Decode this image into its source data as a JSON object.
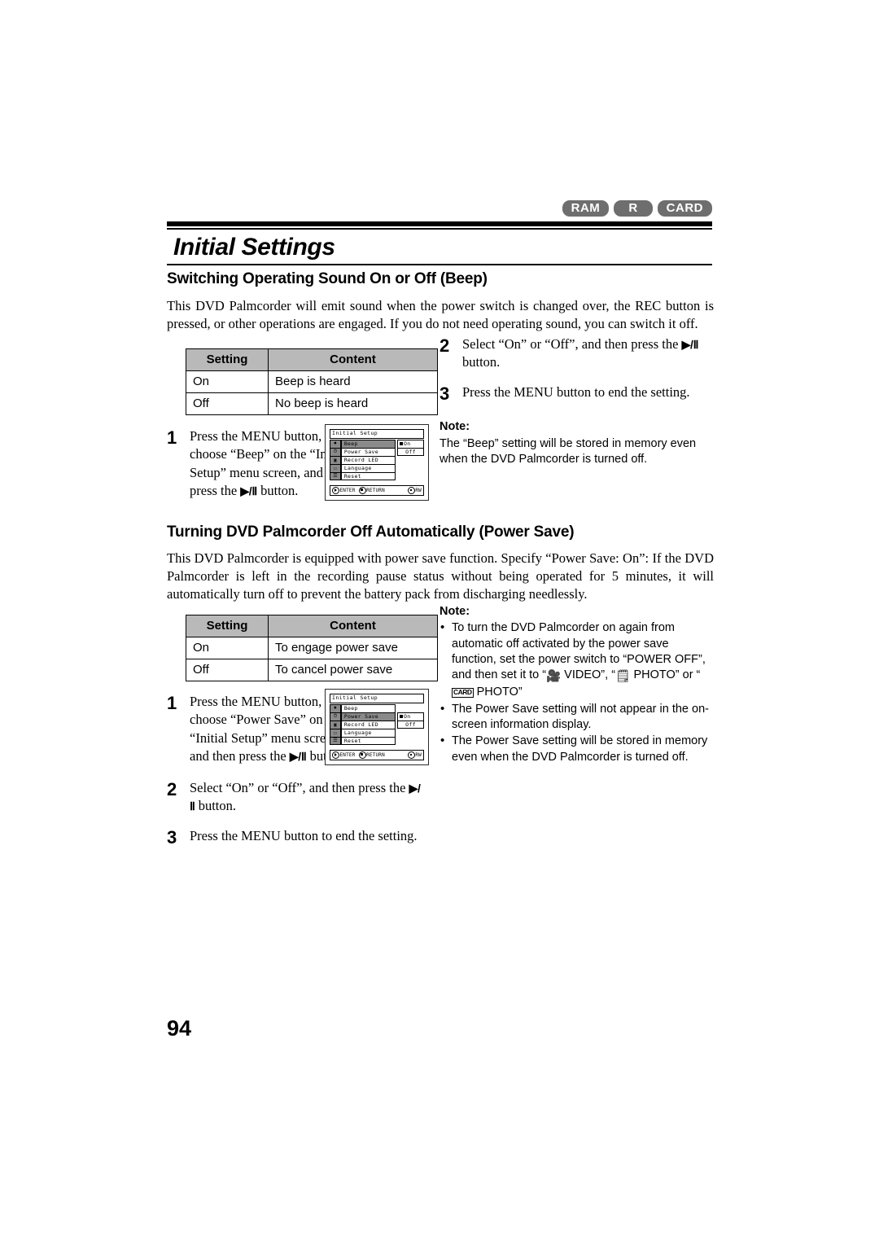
{
  "badges": [
    {
      "label": "RAM"
    },
    {
      "label": "R"
    },
    {
      "label": "CARD"
    }
  ],
  "chapter_title": "Initial Settings",
  "page_number": "94",
  "colors": {
    "badge_bg": "#6e6e6e",
    "table_header_bg": "#b9b9b9",
    "lcd_highlight": "#8a8a8a",
    "rule": "#000000"
  },
  "sections": [
    {
      "heading": "Switching Operating Sound On or Off (Beep)",
      "intro": "This DVD Palmcorder will emit sound when the power switch is changed over, the REC button is pressed, or other operations are engaged. If you do not need operating sound, you can switch it off.",
      "table": {
        "headers": [
          "Setting",
          "Content"
        ],
        "rows": [
          [
            "On",
            "Beep is heard"
          ],
          [
            "Off",
            "No beep is heard"
          ]
        ]
      },
      "steps": [
        {
          "num": "1",
          "text_before": "Press the MENU button, choose “Beep” on the “Initial Setup” menu screen, and then press the ",
          "button": "▶/Ⅱ",
          "text_after": " button."
        },
        {
          "num": "2",
          "text_before": "Select “On” or “Off”, and then press the ",
          "button": "▶/Ⅱ",
          "text_after": " button."
        },
        {
          "num": "3",
          "text_before": "Press the MENU button to end the setting.",
          "button": "",
          "text_after": ""
        }
      ],
      "note": {
        "title": "Note:",
        "items": [
          "The “Beep” setting will be stored in memory even when the DVD Palmcorder is turned off."
        ]
      },
      "lcd": {
        "title": "Initial Setup",
        "items": [
          "Beep",
          "Power Save",
          "Record LED",
          "Language",
          "Reset"
        ],
        "selected_index": 0,
        "submenu": [
          "On",
          "Off"
        ],
        "submenu_selected": "On",
        "footer_enter": "ENTER",
        "footer_return": "RETURN",
        "footer_disc": "RW"
      }
    },
    {
      "heading": "Turning DVD Palmcorder Off Automatically (Power Save)",
      "intro": "This DVD Palmcorder is equipped with power save function. Specify “Power Save: On”: If the DVD Palmcorder is left in the recording pause status without being operated for 5 minutes, it will automatically turn off to prevent the battery pack from discharging needlessly.",
      "table": {
        "headers": [
          "Setting",
          "Content"
        ],
        "rows": [
          [
            "On",
            "To engage power save"
          ],
          [
            "Off",
            "To cancel power save"
          ]
        ]
      },
      "steps": [
        {
          "num": "1",
          "text_before": "Press the MENU button, choose “Power Save” on the “Initial Setup” menu screen, and then press the ",
          "button": "▶/Ⅱ",
          "text_after": " button."
        },
        {
          "num": "2",
          "text_before": "Select “On” or “Off”, and then press the ",
          "button": "▶/Ⅱ",
          "text_after": " button."
        },
        {
          "num": "3",
          "text_before": "Press the MENU button to end the setting.",
          "button": "",
          "text_after": ""
        }
      ],
      "note": {
        "title": "Note:",
        "item1_a": "To turn the DVD Palmcorder on again from automatic off activated by the power save function, set the power switch to “POWER OFF”, and then set it to “",
        "item1_video": " VIDEO”,",
        "item1_b": "“",
        "item1_photo1": " PHOTO” or “",
        "item1_card": "CARD",
        "item1_photo2": " PHOTO”",
        "item2": "The Power Save setting will not appear in the on-screen information display.",
        "item3": "The Power Save setting will be stored in memory even when the DVD Palmcorder is turned off."
      },
      "lcd": {
        "title": "Initial Setup",
        "items": [
          "Beep",
          "Power Save",
          "Record LED",
          "Language",
          "Reset"
        ],
        "selected_index": 1,
        "submenu": [
          "On",
          "Off"
        ],
        "submenu_selected": "On",
        "footer_enter": "ENTER",
        "footer_return": "RETURN",
        "footer_disc": "RW"
      }
    }
  ]
}
